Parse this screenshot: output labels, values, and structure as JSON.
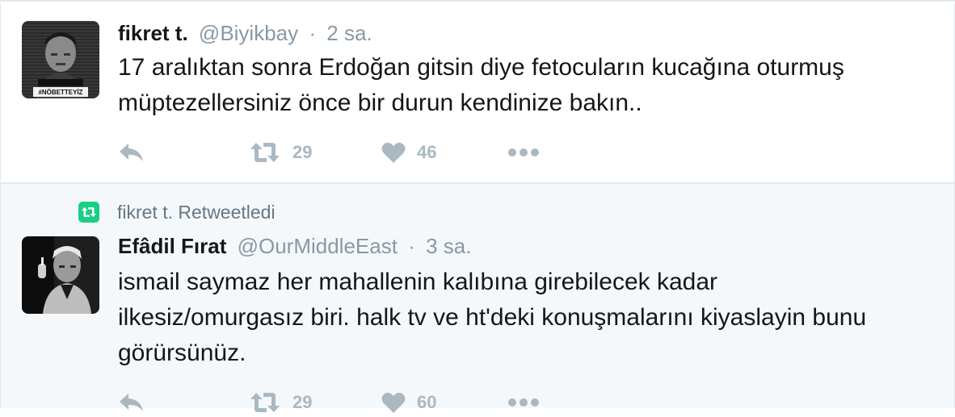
{
  "tweets": [
    {
      "fullname": "fikret t.",
      "username": "@Biyikbay",
      "separator": "·",
      "time": "2 sa.",
      "text_lines": [
        "17 aralıktan sonra Erdoğan gitsin diye fetocuların kucağına oturmuş",
        "müptezellersiniz önce bir durun kendinize bakın.."
      ],
      "avatar_badge": "#NÖBETTEYİZ",
      "actions": {
        "reply_icon": "reply-icon",
        "retweet_icon": "retweet-icon",
        "retweet_count": "29",
        "like_icon": "heart-icon",
        "like_count": "46",
        "more_icon": "more-dots-icon"
      }
    },
    {
      "retweet_context": "fikret t. Retweetledi",
      "fullname": "Efâdil Fırat",
      "username": "@OurMiddleEast",
      "separator": "·",
      "time": "3 sa.",
      "text_lines": [
        "ismail saymaz her mahallenin kalıbına girebilecek kadar",
        "ilkesiz/omurgasız biri. halk tv ve ht'deki konuşmalarını kiyaslayin bunu",
        "görürsünüz."
      ],
      "actions": {
        "reply_icon": "reply-icon",
        "retweet_icon": "retweet-icon",
        "retweet_count": "29",
        "like_icon": "heart-icon",
        "like_count": "60",
        "more_icon": "more-dots-icon"
      }
    }
  ],
  "colors": {
    "text": "#14171a",
    "muted": "#8899a6",
    "icon": "#aab8c2",
    "retweet_green": "#19cf86",
    "retweeted_bg": "#f5f8fa",
    "border": "#e1e8ed"
  }
}
